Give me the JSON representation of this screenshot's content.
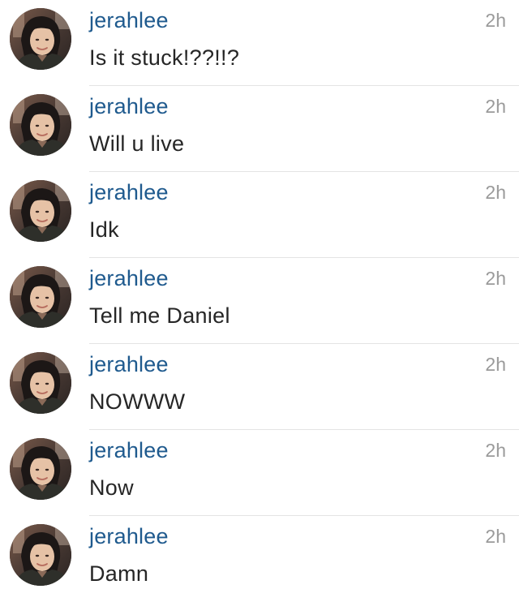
{
  "comments": [
    {
      "username": "jerahlee",
      "message": "Is it stuck!??!!?",
      "time": "2h"
    },
    {
      "username": "jerahlee",
      "message": "Will u live",
      "time": "2h"
    },
    {
      "username": "jerahlee",
      "message": "Idk",
      "time": "2h"
    },
    {
      "username": "jerahlee",
      "message": "Tell me Daniel",
      "time": "2h"
    },
    {
      "username": "jerahlee",
      "message": "NOWWW",
      "time": "2h"
    },
    {
      "username": "jerahlee",
      "message": "Now",
      "time": "2h"
    },
    {
      "username": "jerahlee",
      "message": "Damn",
      "time": "2h"
    }
  ],
  "colors": {
    "username": "#1f5a8e",
    "message": "#262626",
    "time": "#9a9a9a",
    "divider": "#e3e3e3"
  },
  "icons": {
    "avatar": "profile-photo-avatar"
  }
}
